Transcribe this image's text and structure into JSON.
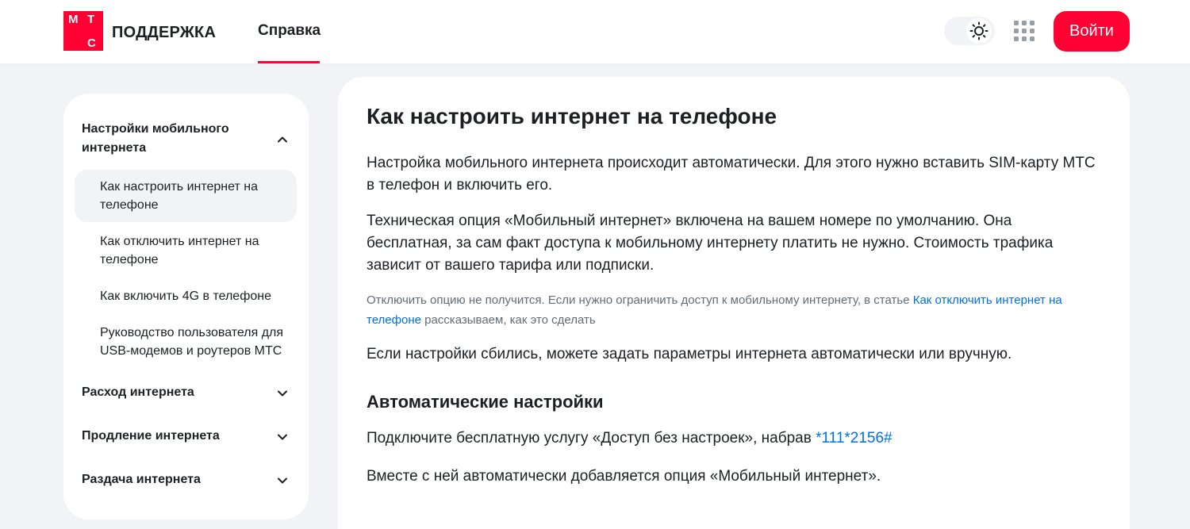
{
  "header": {
    "logo_letters": [
      "М",
      "Т",
      "С"
    ],
    "brand": "ПОДДЕРЖКА",
    "nav_tab": "Справка",
    "theme_icon": "sun-icon",
    "apps_icon": "grid-icon",
    "login_label": "Войти",
    "accent_color": "#ff0032"
  },
  "sidebar": {
    "section_1": {
      "label": "Настройки мобильного интернета",
      "expanded": true
    },
    "items": [
      {
        "label": "Как настроить интернет на телефоне",
        "active": true
      },
      {
        "label": "Как отключить интернет на телефоне"
      },
      {
        "label": "Как включить 4G в телефоне"
      },
      {
        "label": "Руководство пользователя для USB-модемов и роутеров МТС"
      }
    ],
    "sections": [
      {
        "label": "Расход интернета",
        "expanded": false
      },
      {
        "label": "Продление интернета",
        "expanded": false
      },
      {
        "label": "Раздача интернета",
        "expanded": false
      }
    ]
  },
  "article": {
    "title": "Как настроить интернет на телефоне",
    "p1": "Настройка мобильного интернета происходит автоматически. Для этого нужно вставить SIM-карту МТС в телефон и включить его.",
    "p2": "Техническая опция «Мобильный интернет» включена на вашем номере по умолчанию. Она бесплатная, за сам факт доступа к мобильному интернету платить не нужно. Стоимость трафика зависит от вашего тарифа или подписки.",
    "note_before": "Отключить опцию не получится. Если нужно ограничить доступ к мобильному интернету, в статье ",
    "note_link": "Как отключить интернет на телефоне",
    "note_after": " рассказываем, как это сделать",
    "p3": "Если настройки сбились, можете задать параметры интернета автоматически или вручную.",
    "subtitle": "Автоматические настройки",
    "p4_before": "Подключите бесплатную услугу «Доступ без настроек», набрав ",
    "p4_code": "*111*2156#",
    "p5": "Вместе с ней автоматически добавляется опция «Мобильный интернет».",
    "link_color": "#0070e5"
  }
}
